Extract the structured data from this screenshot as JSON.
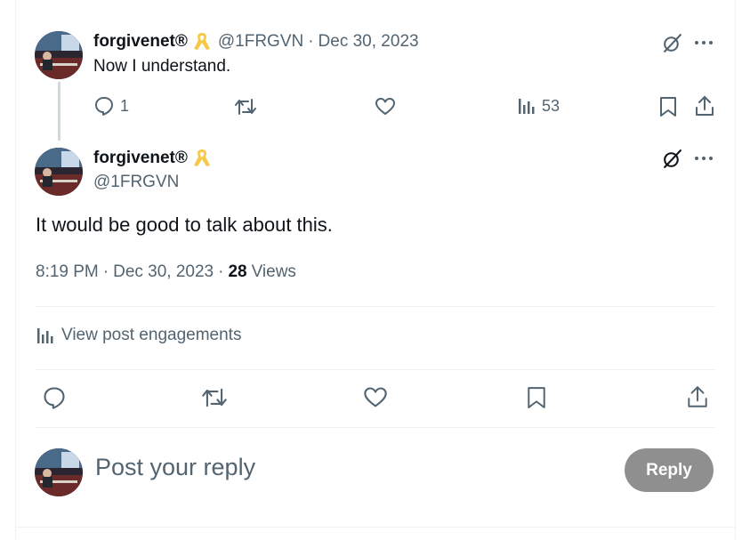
{
  "parent_post": {
    "display_name": "forgivenet®",
    "handle": "@1FRGVN",
    "separator": "·",
    "date": "Dec 30, 2023",
    "text": "Now I understand.",
    "reply_count": "1",
    "view_count": "53"
  },
  "main_post": {
    "display_name": "forgivenet®",
    "handle": "@1FRGVN",
    "text": "It would be good to talk about this.",
    "time": "8:19 PM",
    "sep1": "·",
    "date": "Dec 30, 2023",
    "sep2": "·",
    "views_count": "28",
    "views_label": "Views",
    "engagements_label": "View post engagements"
  },
  "reply_composer": {
    "placeholder": "Post your reply",
    "button_label": "Reply"
  },
  "colors": {
    "text_primary": "#0f1419",
    "text_secondary": "#536471",
    "divider": "#eff3f4",
    "ribbon": "#f7c948",
    "reply_button_disabled": "#8f8f8f"
  },
  "icons": [
    "ribbon-icon",
    "grok-icon",
    "more-icon",
    "reply-icon",
    "repost-icon",
    "like-icon",
    "views-icon",
    "bookmark-icon",
    "share-icon",
    "engagements-icon"
  ]
}
